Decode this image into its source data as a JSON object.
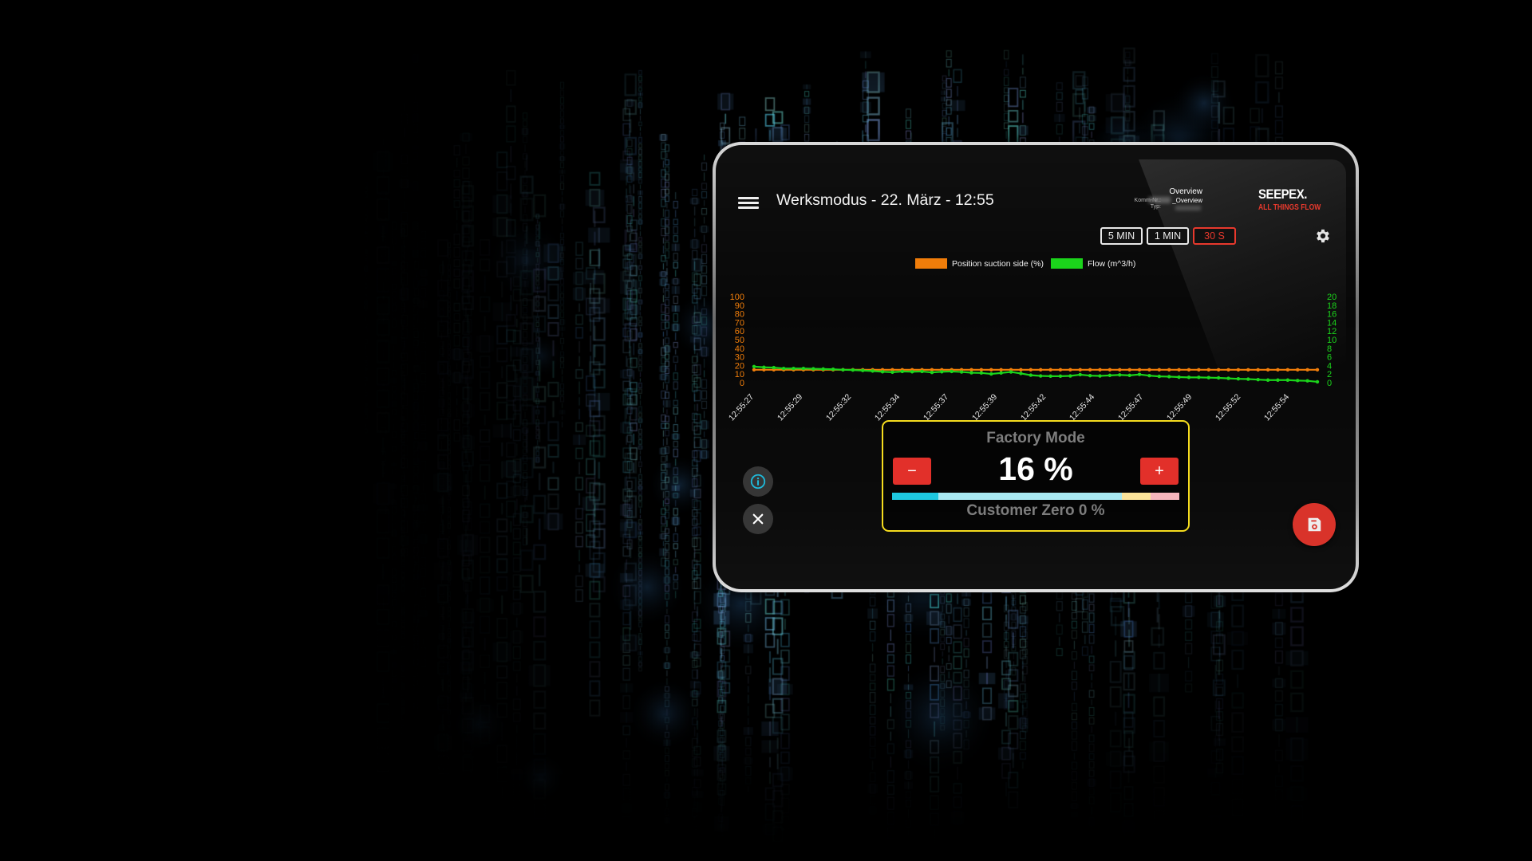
{
  "header": {
    "title": "Werksmodus - 22. März - 12:55",
    "info": {
      "overview_title": "Overview",
      "komm_label": "Komm-Nr.:",
      "komm_value": "_Overview",
      "typ_label": "Typ:"
    },
    "logo": {
      "main": "SEEPEX.",
      "tagline": "ALL THINGS FLOW"
    },
    "time_ranges": [
      {
        "label": "5 MIN",
        "active": false
      },
      {
        "label": "1 MIN",
        "active": false
      },
      {
        "label": "30 S",
        "active": true
      }
    ],
    "icons": {
      "menu": "hamburger-menu-icon",
      "settings": "gear-icon"
    }
  },
  "colors": {
    "accent_red": "#e2302a",
    "orange_series": "#f07d0a",
    "green_series": "#1bd41b",
    "panel_border": "#f5dc1e",
    "info_icon": "#1fb9d9"
  },
  "chart_data": {
    "type": "line",
    "title": "",
    "legend_position": "top-center",
    "legend": [
      "Position suction side (%)",
      "Flow (m^3/h)"
    ],
    "x_tick_labels": [
      "12:55:27",
      "12:55:29",
      "12:55:32",
      "12:55:34",
      "12:55:37",
      "12:55:39",
      "12:55:42",
      "12:55:44",
      "12:55:47",
      "12:55:49",
      "12:55:52",
      "12:55:54"
    ],
    "y_left": {
      "label": "",
      "range": [
        0,
        100
      ],
      "ticks": [
        0,
        10,
        20,
        30,
        40,
        50,
        60,
        70,
        80,
        90,
        100
      ],
      "color": "#f07d0a"
    },
    "y_right": {
      "label": "",
      "range": [
        0,
        20
      ],
      "ticks": [
        0,
        2,
        4,
        6,
        8,
        10,
        12,
        14,
        16,
        18,
        20
      ],
      "color": "#1bd41b"
    },
    "grid": false,
    "series": [
      {
        "name": "Position suction side (%)",
        "axis": "left",
        "color": "#f07d0a",
        "values": [
          15,
          15,
          15,
          15,
          15,
          15,
          15,
          15,
          15,
          15,
          15,
          15,
          15,
          15,
          15,
          15,
          15,
          15,
          15,
          15,
          15,
          15,
          15,
          15,
          15,
          15,
          15,
          15,
          15,
          15,
          15,
          15,
          15,
          15,
          15,
          15,
          15,
          15,
          15,
          15,
          15,
          15,
          15,
          15,
          15,
          15,
          15,
          15,
          15,
          15,
          15,
          15,
          15,
          15,
          15,
          15,
          15,
          15
        ]
      },
      {
        "name": "Flow (m^3/h)",
        "axis": "right",
        "color": "#1bd41b",
        "values": [
          3.74,
          3.57,
          3.51,
          3.29,
          3.29,
          3.29,
          3.23,
          3.17,
          3.11,
          3.0,
          2.94,
          2.83,
          2.71,
          2.54,
          2.43,
          2.6,
          2.54,
          2.6,
          2.37,
          2.54,
          2.6,
          2.49,
          2.31,
          2.26,
          2.03,
          2.26,
          2.49,
          2.14,
          1.74,
          1.57,
          1.51,
          1.51,
          1.57,
          1.86,
          1.63,
          1.57,
          1.69,
          1.8,
          1.69,
          1.91,
          1.63,
          1.46,
          1.4,
          1.29,
          1.23,
          1.23,
          1.17,
          1.11,
          1.0,
          0.89,
          0.83,
          0.71,
          0.6,
          0.6,
          0.6,
          0.49,
          0.43,
          0.2
        ]
      }
    ]
  },
  "factory_panel": {
    "title": "Factory Mode",
    "value_label": "16 %",
    "value_percent": 16,
    "minus_label": "−",
    "plus_label": "+",
    "subtitle": "Customer Zero 0 %",
    "bar_segments": [
      {
        "name": "cyan",
        "fraction": 0.16,
        "color": "#1ec8e0"
      },
      {
        "name": "light-cyan",
        "fraction": 0.64,
        "color": "#a9e9f2"
      },
      {
        "name": "yellow",
        "fraction": 0.1,
        "color": "#fbe39a"
      },
      {
        "name": "pink",
        "fraction": 0.1,
        "color": "#f6b6bd"
      }
    ]
  },
  "side_buttons": {
    "info": "info-icon",
    "close": "close-icon"
  },
  "fab": {
    "icon": "save-floppy-icon"
  }
}
